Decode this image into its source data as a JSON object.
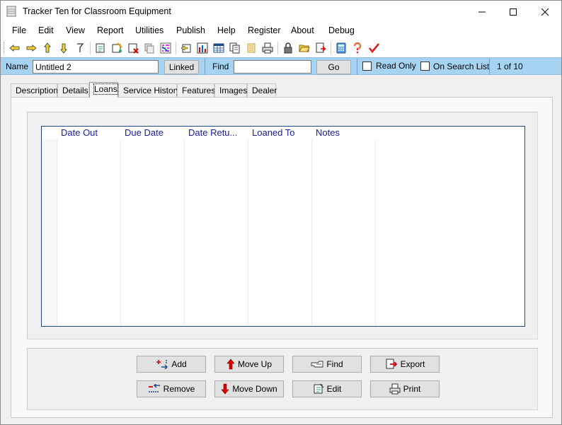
{
  "window": {
    "title": "Tracker Ten for Classroom Equipment"
  },
  "menu": [
    "File",
    "Edit",
    "View",
    "Report",
    "Utilities",
    "Publish",
    "Help",
    "Register",
    "About",
    "Debug"
  ],
  "toolbar": {
    "icons": [
      "hand-left-icon",
      "hand-right-icon",
      "hand-up-icon",
      "hand-down-icon",
      "pointer-icon",
      "edit-record-icon",
      "add-record-icon",
      "delete-record-icon",
      "copy-record-icon",
      "sort-icon",
      "find-icon",
      "chart-icon",
      "table-icon",
      "copy-icon",
      "clear-icon",
      "print-icon",
      "lock-icon",
      "open-folder-icon",
      "export-icon",
      "calculator-icon",
      "help-icon",
      "check-icon"
    ]
  },
  "namebar": {
    "name_label": "Name",
    "name_value": "Untitled 2",
    "linked_label": "Linked",
    "find_label": "Find",
    "find_value": "",
    "go_label": "Go",
    "read_only_label": "Read Only",
    "search_list_label": "On Search List",
    "record_position": "1 of 10"
  },
  "tabs": [
    "Description",
    "Details",
    "Loans",
    "Service History",
    "Features",
    "Images",
    "Dealer"
  ],
  "active_tab": "Loans",
  "grid": {
    "columns": [
      "Date Out",
      "Due Date",
      "Date Retu...",
      "Loaned To",
      "Notes"
    ],
    "rows": []
  },
  "actions": {
    "add": "Add",
    "move_up": "Move Up",
    "find": "Find",
    "export": "Export",
    "remove": "Remove",
    "move_down": "Move Down",
    "edit": "Edit",
    "print": "Print"
  },
  "colors": {
    "namebar_bg": "#a7d3f3",
    "grid_header_text": "#1a1a9e",
    "grid_border": "#1c4a8a"
  }
}
